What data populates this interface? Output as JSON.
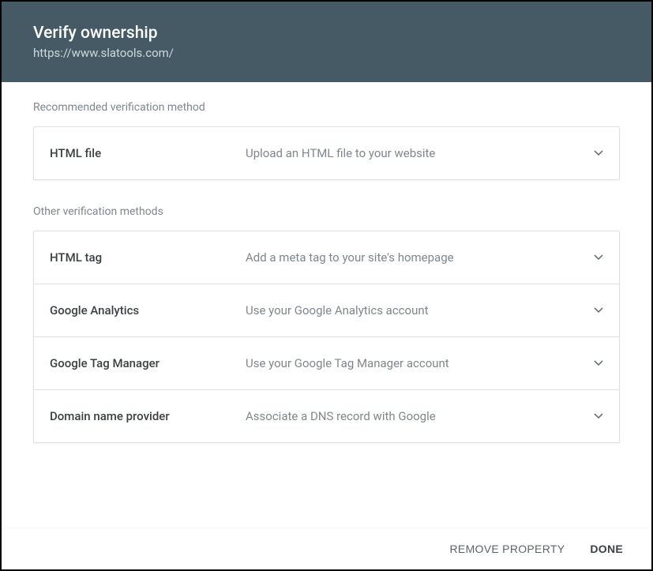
{
  "header": {
    "title": "Verify ownership",
    "subtitle": "https://www.slatools.com/"
  },
  "sections": {
    "recommended_label": "Recommended verification method",
    "other_label": "Other verification methods"
  },
  "methods": {
    "recommended": {
      "name": "HTML file",
      "desc": "Upload an HTML file to your website"
    },
    "other": [
      {
        "name": "HTML tag",
        "desc": "Add a meta tag to your site's homepage"
      },
      {
        "name": "Google Analytics",
        "desc": "Use your Google Analytics account"
      },
      {
        "name": "Google Tag Manager",
        "desc": "Use your Google Tag Manager account"
      },
      {
        "name": "Domain name provider",
        "desc": "Associate a DNS record with Google"
      }
    ]
  },
  "footer": {
    "remove": "REMOVE PROPERTY",
    "done": "DONE"
  }
}
